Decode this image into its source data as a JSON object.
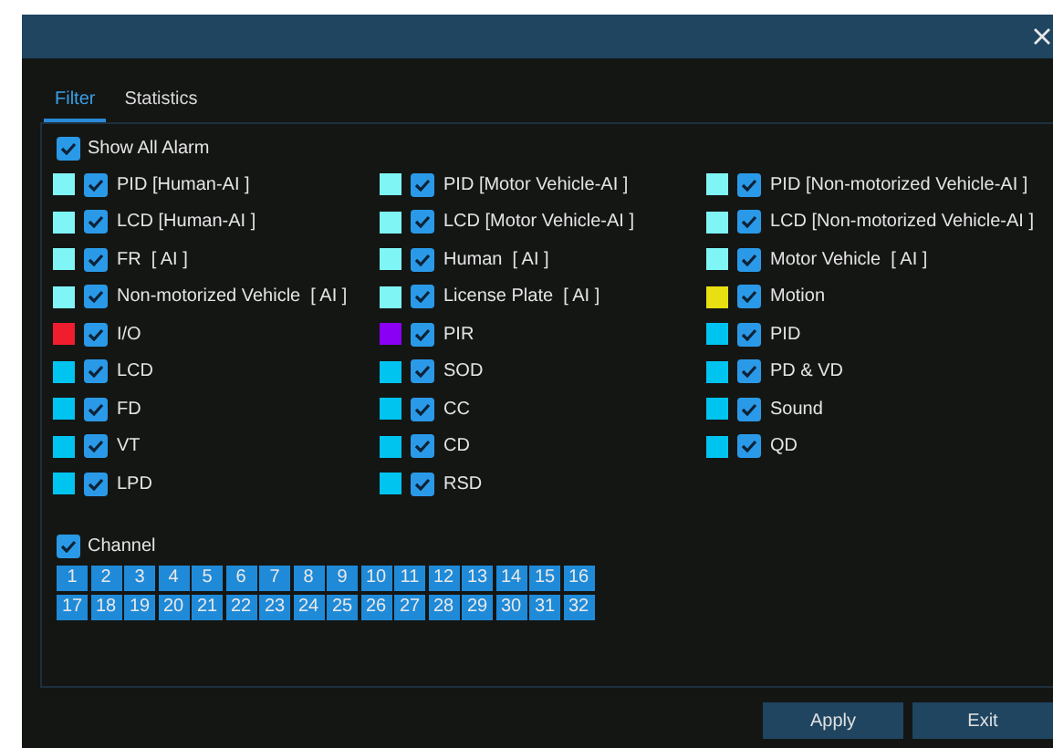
{
  "tabs": [
    {
      "label": "Filter",
      "selected": true
    },
    {
      "label": "Statistics",
      "selected": false
    }
  ],
  "show_all_alarm": {
    "label": "Show All Alarm",
    "checked": true
  },
  "alarm_columns": [
    [
      {
        "label": "PID [Human-AI ]",
        "color": "#7ff5f5",
        "checked": true
      },
      {
        "label": "LCD [Human-AI ]",
        "color": "#7ff5f5",
        "checked": true
      },
      {
        "label": "FR  [ AI ]",
        "color": "#7ff5f5",
        "checked": true
      },
      {
        "label": "Non-motorized Vehicle  [ AI ]",
        "color": "#7ff5f5",
        "checked": true
      },
      {
        "label": "I/O",
        "color": "#f01d2e",
        "checked": true
      },
      {
        "label": "LCD",
        "color": "#00c4f0",
        "checked": true
      },
      {
        "label": "FD",
        "color": "#00c4f0",
        "checked": true
      },
      {
        "label": "VT",
        "color": "#00c4f0",
        "checked": true
      },
      {
        "label": "LPD",
        "color": "#00c4f0",
        "checked": true
      }
    ],
    [
      {
        "label": "PID [Motor Vehicle-AI ]",
        "color": "#7ff5f5",
        "checked": true
      },
      {
        "label": "LCD [Motor Vehicle-AI ]",
        "color": "#7ff5f5",
        "checked": true
      },
      {
        "label": "Human  [ AI ]",
        "color": "#7ff5f5",
        "checked": true
      },
      {
        "label": "License Plate  [ AI ]",
        "color": "#7ff5f5",
        "checked": true
      },
      {
        "label": "PIR",
        "color": "#8a00f5",
        "checked": true
      },
      {
        "label": "SOD",
        "color": "#00c4f0",
        "checked": true
      },
      {
        "label": "CC",
        "color": "#00c4f0",
        "checked": true
      },
      {
        "label": "CD",
        "color": "#00c4f0",
        "checked": true
      },
      {
        "label": "RSD",
        "color": "#00c4f0",
        "checked": true
      }
    ],
    [
      {
        "label": "PID [Non-motorized Vehicle-AI ]",
        "color": "#7ff5f5",
        "checked": true
      },
      {
        "label": "LCD [Non-motorized Vehicle-AI ]",
        "color": "#7ff5f5",
        "checked": true
      },
      {
        "label": "Motor Vehicle  [ AI ]",
        "color": "#7ff5f5",
        "checked": true
      },
      {
        "label": "Motion",
        "color": "#e8e010",
        "checked": true
      },
      {
        "label": "PID",
        "color": "#00c4f0",
        "checked": true
      },
      {
        "label": "PD & VD",
        "color": "#00c4f0",
        "checked": true
      },
      {
        "label": "Sound",
        "color": "#00c4f0",
        "checked": true
      },
      {
        "label": "QD",
        "color": "#00c4f0",
        "checked": true
      }
    ]
  ],
  "channel": {
    "label": "Channel",
    "checked": true,
    "channels": [
      {
        "label": "1",
        "selected": true
      },
      {
        "label": "2",
        "selected": true
      },
      {
        "label": "3",
        "selected": true
      },
      {
        "label": "4",
        "selected": true
      },
      {
        "label": "5",
        "selected": true
      },
      {
        "label": "6",
        "selected": true
      },
      {
        "label": "7",
        "selected": true
      },
      {
        "label": "8",
        "selected": true
      },
      {
        "label": "9",
        "selected": true
      },
      {
        "label": "10",
        "selected": true
      },
      {
        "label": "11",
        "selected": true
      },
      {
        "label": "12",
        "selected": true
      },
      {
        "label": "13",
        "selected": true
      },
      {
        "label": "14",
        "selected": true
      },
      {
        "label": "15",
        "selected": true
      },
      {
        "label": "16",
        "selected": true
      },
      {
        "label": "17",
        "selected": true
      },
      {
        "label": "18",
        "selected": true
      },
      {
        "label": "19",
        "selected": true
      },
      {
        "label": "20",
        "selected": true
      },
      {
        "label": "21",
        "selected": true
      },
      {
        "label": "22",
        "selected": true
      },
      {
        "label": "23",
        "selected": true
      },
      {
        "label": "24",
        "selected": true
      },
      {
        "label": "25",
        "selected": true
      },
      {
        "label": "26",
        "selected": true
      },
      {
        "label": "27",
        "selected": true
      },
      {
        "label": "28",
        "selected": true
      },
      {
        "label": "29",
        "selected": true
      },
      {
        "label": "30",
        "selected": true
      },
      {
        "label": "31",
        "selected": true
      },
      {
        "label": "32",
        "selected": true
      }
    ]
  },
  "buttons": [
    "Apply",
    "Exit"
  ]
}
